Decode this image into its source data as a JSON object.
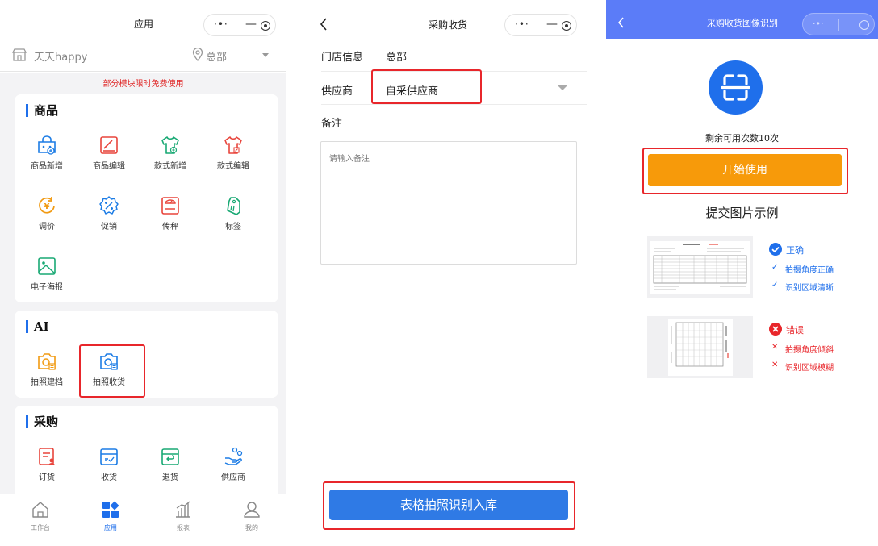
{
  "panel1": {
    "title": "应用",
    "store_name": "天天happy",
    "location": "总部",
    "notice": "部分模块限时免费使用",
    "sections": [
      {
        "title": "商品",
        "items": [
          "商品新增",
          "商品编辑",
          "款式新增",
          "款式编辑",
          "调价",
          "促销",
          "传秤",
          "标签",
          "电子海报"
        ]
      },
      {
        "title": "AI",
        "items": [
          "拍照建档",
          "拍照收货"
        ]
      },
      {
        "title": "采购",
        "items": [
          "订货",
          "收货",
          "退货",
          "供应商"
        ]
      }
    ],
    "tabbar": [
      "工作台",
      "应用",
      "报表",
      "我的"
    ]
  },
  "panel2": {
    "title": "采购收货",
    "store_label": "门店信息",
    "store_value": "总部",
    "supplier_label": "供应商",
    "supplier_value": "自采供应商",
    "remark_label": "备注",
    "remark_placeholder": "请输入备注",
    "submit_label": "表格拍照识别入库"
  },
  "panel3": {
    "title": "采购收货图像识别",
    "remaining": "剩余可用次数10次",
    "start_label": "开始使用",
    "example_title": "提交图片示例",
    "correct": {
      "heading": "正确",
      "points": [
        "拍摄角度正确",
        "识别区域清晰"
      ]
    },
    "wrong": {
      "heading": "错误",
      "points": [
        "拍摄角度倾斜",
        "识别区域模糊"
      ]
    }
  },
  "colors": {
    "accent_blue": "#1f6feb",
    "header_purple_blue": "#5b7cf8",
    "button_orange": "#f79a0a",
    "highlight_red": "#e8262b",
    "notice_red": "#e02828",
    "icon_red": "#e8453c",
    "icon_green": "#19a974",
    "icon_orange": "#f19a12",
    "icon_blue": "#1c7ce5"
  },
  "icons": {
    "store": "store-icon",
    "location": "location-pin-icon",
    "dropdown": "triangle-down-icon",
    "scan": "scan-frame-icon",
    "check": "check-circle-icon",
    "cross": "cross-circle-icon"
  }
}
